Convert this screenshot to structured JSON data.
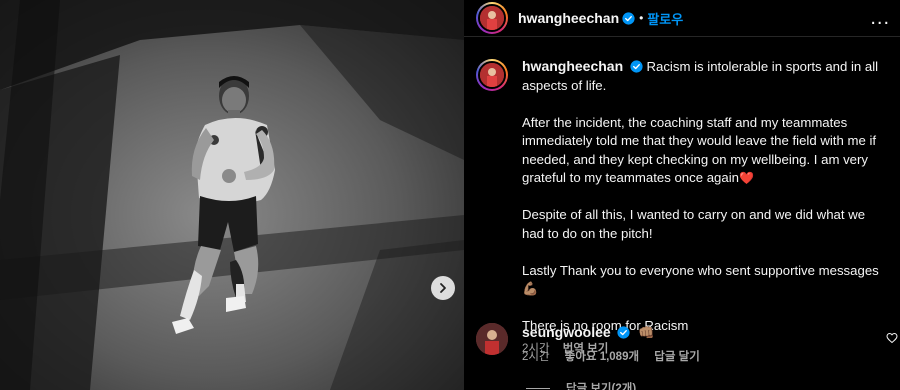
{
  "post": {
    "username": "hwangheechan",
    "dot": "•",
    "follow_label": "팔로우",
    "more_label": "..."
  },
  "caption": {
    "username": "hwangheechan",
    "text_first": "Racism is intolerable in sports and in all aspects of life.",
    "para2": "After the incident, the coaching staff and my teammates immediately told me that they would leave the field with me if needed, and they kept checking on my wellbeing. I am very grateful to my teammates once again",
    "para2_emoji": "❤️",
    "para3": "Despite of all this, I wanted to carry on and we did what we had to do on the pitch!",
    "para4": "Lastly Thank you to everyone who sent supportive messages",
    "para4_emoji": "💪🏽",
    "para5": "There is no room for Racism",
    "time": "2시간",
    "translate_label": "번역 보기"
  },
  "comment": {
    "username": "seungwoolee",
    "text": "👊🏽",
    "time": "2시간",
    "likes": "좋아요 1,089개",
    "reply_label": "답글 달기"
  },
  "replies_label": "답글 보기(2개)",
  "icons": {
    "verified": "verified-badge-icon",
    "heart": "heart-outline-icon",
    "next": "chevron-right-icon",
    "more": "more-options-icon"
  },
  "colors": {
    "accent": "#0095f6",
    "background": "#000000",
    "secondary_text": "#a8a8a8",
    "heart_emoji": "#e0245e"
  }
}
